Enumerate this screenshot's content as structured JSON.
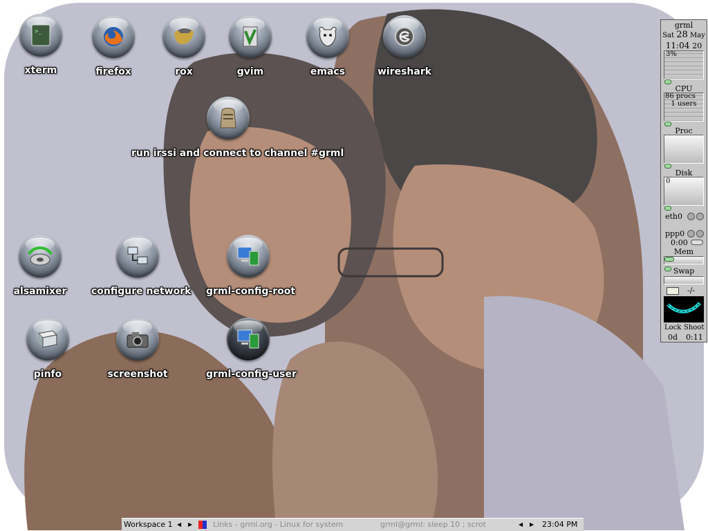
{
  "desktop": {
    "icons": [
      {
        "label": "xterm",
        "icon": "terminal-icon"
      },
      {
        "label": "firefox",
        "icon": "firefox-icon"
      },
      {
        "label": "rox",
        "icon": "rox-icon"
      },
      {
        "label": "gvim",
        "icon": "gvim-icon"
      },
      {
        "label": "emacs",
        "icon": "gnu-icon"
      },
      {
        "label": "wireshark",
        "icon": "wireshark-icon"
      },
      {
        "label": "run irssi and connect to channel #grml",
        "icon": "irssi-icon"
      },
      {
        "label": "alsamixer",
        "icon": "speaker-icon"
      },
      {
        "label": "configure network",
        "icon": "network-icon"
      },
      {
        "label": "grml-config-root",
        "icon": "computer-config-icon"
      },
      {
        "label": "pinfo",
        "icon": "book-icon"
      },
      {
        "label": "screenshot",
        "icon": "camera-icon"
      },
      {
        "label": "grml-config-user",
        "icon": "computer-config-icon"
      }
    ]
  },
  "dock": {
    "hostname": "grml",
    "date": {
      "weekday": "Sat",
      "day": "28",
      "month": "May"
    },
    "time": {
      "hm": "11:04",
      "s": "20"
    },
    "cpu": {
      "percent_label": "3%",
      "label": "CPU"
    },
    "procs": {
      "procs_label": "86 procs",
      "users_label": "1 users",
      "label": "Proc"
    },
    "disk": {
      "value_label": "0",
      "label": "Disk"
    },
    "net": {
      "eth_label": "eth0",
      "ppp_label": "ppp0",
      "ppp_time": "0:00"
    },
    "mem": {
      "label": "Mem"
    },
    "swap": {
      "label": "Swap"
    },
    "mail": {
      "label": "-/-"
    },
    "lock": {
      "lock_label": "Lock",
      "shoot_label": "Shoot",
      "uptime_days": "0d",
      "uptime_time": "0:11"
    }
  },
  "taskbar": {
    "workspace": "Workspace 1",
    "tasks": [
      {
        "label": "Links - grml.org - Linux for system"
      },
      {
        "label": "grml@grml: sleep 10 ; scrot"
      }
    ],
    "clock": "23:04 PM"
  },
  "colors": {
    "wallpaper_bg": "#c0c0cf",
    "skin_light": "#b58e79",
    "skin_dark": "#5b5251",
    "hair": "#4b4747"
  }
}
